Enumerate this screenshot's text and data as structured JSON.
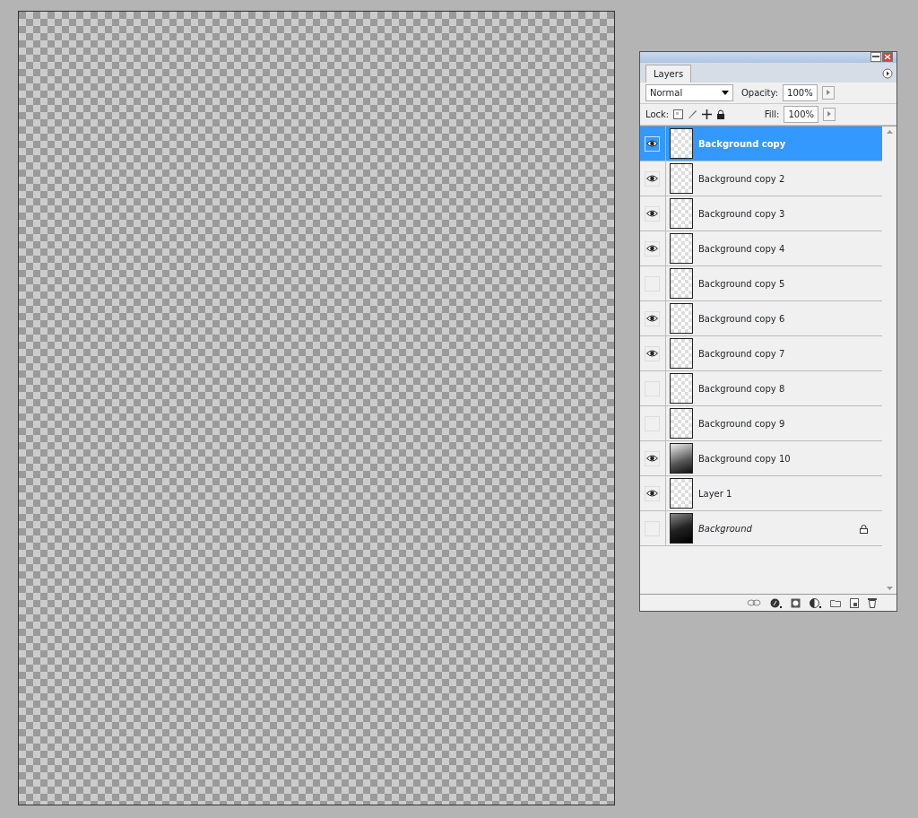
{
  "panel": {
    "tab": "Layers",
    "blend_mode": "Normal",
    "opacity_label": "Opacity:",
    "opacity": "100%",
    "lock_label": "Lock:",
    "fill_label": "Fill:",
    "fill": "100%"
  },
  "layers": [
    {
      "name": "Background copy",
      "visible": true,
      "selected": true,
      "kind": "transparent",
      "locked": false
    },
    {
      "name": "Background copy 2",
      "visible": true,
      "selected": false,
      "kind": "transparent",
      "locked": false
    },
    {
      "name": "Background copy 3",
      "visible": true,
      "selected": false,
      "kind": "transparent",
      "locked": false
    },
    {
      "name": "Background copy 4",
      "visible": true,
      "selected": false,
      "kind": "transparent",
      "locked": false
    },
    {
      "name": "Background copy 5",
      "visible": false,
      "selected": false,
      "kind": "transparent",
      "locked": false
    },
    {
      "name": "Background copy 6",
      "visible": true,
      "selected": false,
      "kind": "transparent",
      "locked": false
    },
    {
      "name": "Background copy 7",
      "visible": true,
      "selected": false,
      "kind": "transparent",
      "locked": false
    },
    {
      "name": "Background copy 8",
      "visible": false,
      "selected": false,
      "kind": "transparent",
      "locked": false
    },
    {
      "name": "Background copy 9",
      "visible": false,
      "selected": false,
      "kind": "transparent",
      "locked": false
    },
    {
      "name": "Background copy 10",
      "visible": true,
      "selected": false,
      "kind": "image",
      "locked": false
    },
    {
      "name": "Layer 1",
      "visible": true,
      "selected": false,
      "kind": "transparent",
      "locked": false
    },
    {
      "name": "Background",
      "visible": false,
      "selected": false,
      "kind": "background",
      "locked": true
    }
  ]
}
